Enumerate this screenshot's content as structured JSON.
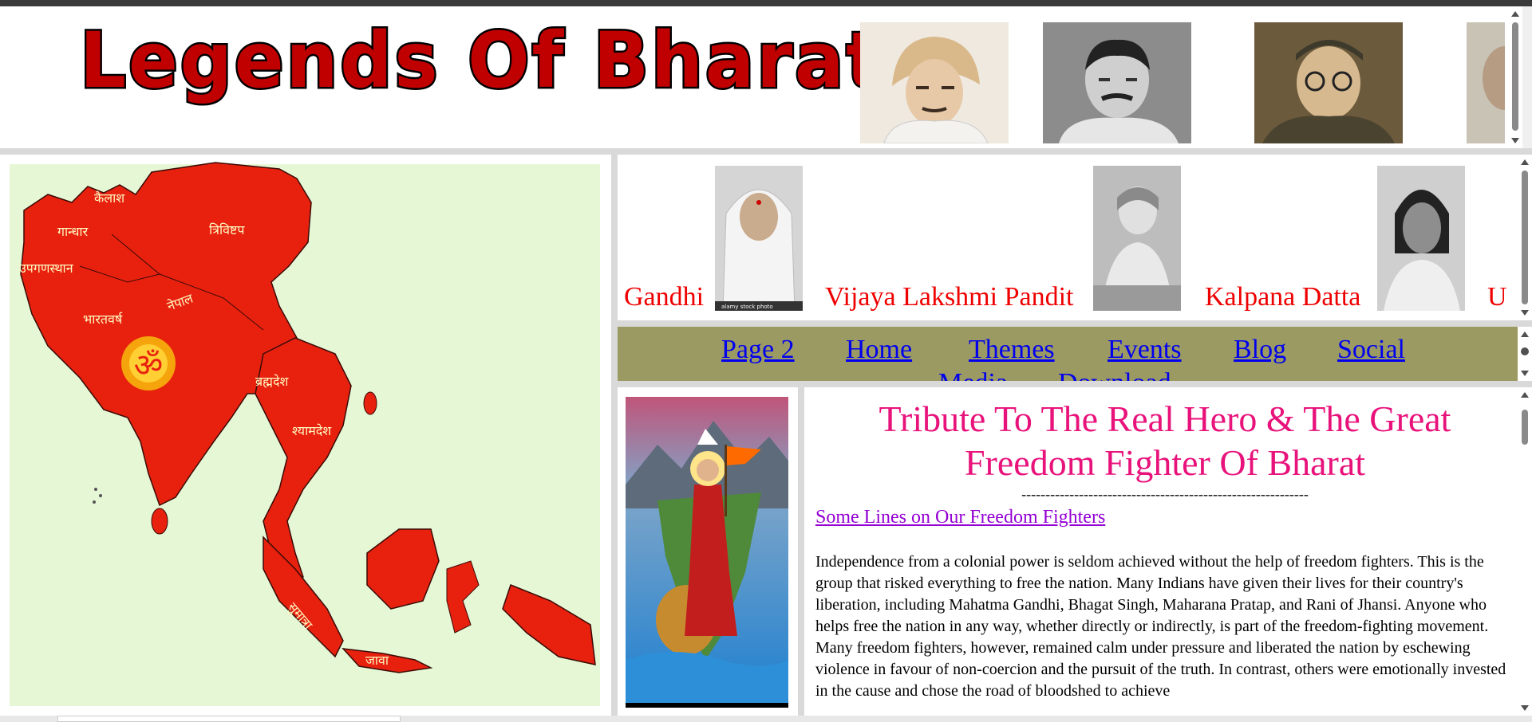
{
  "header": {
    "logo_text": "Legends Of Bharat",
    "portraits": [
      "portrait-turban-icon",
      "portrait-mustache-icon",
      "portrait-glasses-cap-icon"
    ]
  },
  "map": {
    "labels": [
      "कैलाश",
      "गान्धार",
      "त्रिविष्टप",
      "उपगणस्थान",
      "नेपाल",
      "भारतवर्ष",
      "ब्रह्मदेश",
      "श्यामदेश",
      "सुमात्रा",
      "जावा"
    ],
    "om": "ॐ"
  },
  "scroller": {
    "names": [
      "Gandhi",
      "Vijaya Lakshmi Pandit",
      "Kalpana Datta",
      "U"
    ],
    "stock_caption": "alamy stock photo"
  },
  "nav": {
    "links": [
      "Page 2",
      "Home",
      "Themes",
      "Events",
      "Blog",
      "Social",
      "Media",
      "Download"
    ]
  },
  "content": {
    "title": "Tribute To The Real Hero & The Great Freedom Fighter Of Bharat",
    "dashes": "------------------------------------------------------------",
    "sublink": "Some Lines on Our Freedom Fighters",
    "paragraph": "Independence from a colonial power is seldom achieved without the help of freedom fighters. This is the group that risked everything to free the nation. Many Indians have given their lives for their country's liberation, including Mahatma Gandhi, Bhagat Singh, Maharana Pratap, and Rani of Jhansi. Anyone who helps free the nation in any way, whether directly or indirectly, is part of the freedom-fighting movement. Many freedom fighters, however, remained calm under pressure and liberated the nation by eschewing violence in favour of non-coercion and the pursuit of the truth. In contrast, others were emotionally invested in the cause and chose the road of bloodshed to achieve"
  },
  "colors": {
    "title": "#e8127b",
    "link": "#0000ee",
    "visited": "#9400d3",
    "nav_bg": "#9b9a63",
    "name_red": "#ee0000",
    "map_bg": "#e6f7d6",
    "map_red": "#e8210f"
  }
}
